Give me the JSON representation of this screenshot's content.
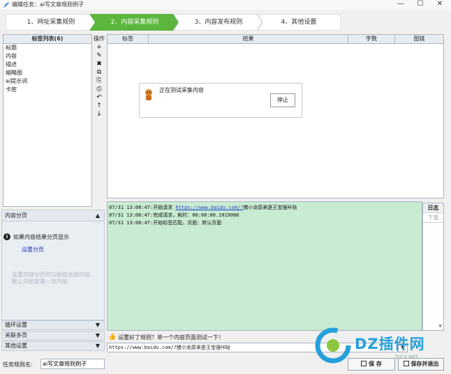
{
  "window": {
    "title": "编辑任务：ai写文章规则例子",
    "minimize": "—",
    "maximize": "☐",
    "close": "✕"
  },
  "steps": [
    {
      "label": "1、网址采集规则",
      "active": false
    },
    {
      "label": "2、内容采集规则",
      "active": true
    },
    {
      "label": "3、内容发布规则",
      "active": false
    },
    {
      "label": "4、其他设置",
      "active": false
    }
  ],
  "tag_list": {
    "header": "标签列表(6)",
    "items": [
      "标题",
      "内容",
      "描述",
      "缩略图",
      "ai提示词",
      "卡密"
    ]
  },
  "ops": {
    "title": "操作",
    "buttons": [
      "+",
      "✎",
      "✖",
      "⧉",
      "⎘",
      "⎙",
      "↶",
      "↑",
      "↓"
    ]
  },
  "table": {
    "columns": [
      "标签",
      "结果",
      "字数",
      "图链"
    ]
  },
  "popup": {
    "message": "正在测试采集内容",
    "stop_label": "停止"
  },
  "log": {
    "lines": [
      {
        "prefix": "07/31 13:08:47:开始请求 ",
        "url": "https://www.baidu.com/?",
        "suffix": "猪小龙原来是王宝强咔哒"
      },
      {
        "prefix": "07/31 13:08:47:完成请求，耗时：00:00:00.1019006",
        "url": "",
        "suffix": ""
      },
      {
        "prefix": "07/31 13:08:47:开始标签匹配，页面：默认页面",
        "url": "",
        "suffix": ""
      }
    ]
  },
  "side_tabs": [
    {
      "label": "日志",
      "state": "selected"
    },
    {
      "label": "下载",
      "state": "disabled"
    }
  ],
  "pagination": {
    "header": "内容分页",
    "info": "如果内容结果分页显示",
    "link": "设置分页",
    "note": "设置内容分页可以抓取全部内容，默认只抓取第一页内容"
  },
  "collapsibles": [
    "循环设置",
    "关联多页",
    "其他设置"
  ],
  "hint": "设置好了规则？单一个内容页面测试一下！",
  "test_url": "https://www.baidu.com/?猪小龙原来是王宝强咔哒",
  "task_name": {
    "label": "任务规则名:",
    "value": "ai写文章规则例子"
  },
  "buttons": {
    "save": "保 存",
    "save_exit": "保存并退出"
  },
  "watermark": {
    "text": "DZ插件网",
    "sub": "DZ-X.NET"
  },
  "colors": {
    "active_step": "#5cb53c",
    "log_bg": "#c8ebd2",
    "watermark": "#26a0da"
  }
}
